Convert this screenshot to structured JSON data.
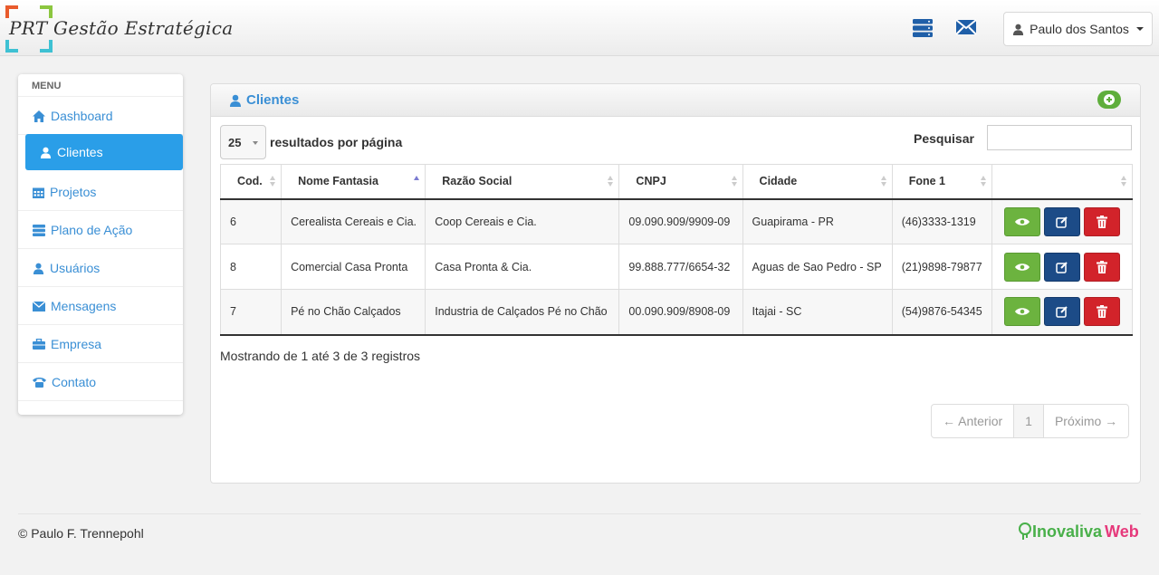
{
  "header": {
    "brand": "PRT Gestão Estratégica",
    "user_name": "Paulo dos Santos",
    "icons": [
      "server-icon",
      "envelope-icon"
    ],
    "brand_colors": [
      "#e95b2c",
      "#8cc63f",
      "#3ec1d3"
    ]
  },
  "sidebar": {
    "title": "MENU",
    "items": [
      {
        "label": "Dashboard",
        "icon": "home-icon",
        "active": false
      },
      {
        "label": "Clientes",
        "icon": "user-icon",
        "active": true
      },
      {
        "label": "Projetos",
        "icon": "calendar-icon",
        "active": false
      },
      {
        "label": "Plano de Ação",
        "icon": "list-icon",
        "active": false
      },
      {
        "label": "Usuários",
        "icon": "user-icon",
        "active": false
      },
      {
        "label": "Mensagens",
        "icon": "envelope-icon",
        "active": false
      },
      {
        "label": "Empresa",
        "icon": "briefcase-icon",
        "active": false
      },
      {
        "label": "Contato",
        "icon": "phone-icon",
        "active": false
      }
    ]
  },
  "panel": {
    "title": "Clientes",
    "per_page_value": "25",
    "per_page_label": "resultados por página",
    "search_label": "Pesquisar",
    "search_value": "",
    "columns": [
      "Cod.",
      "Nome Fantasia",
      "Razão Social",
      "CNPJ",
      "Cidade",
      "Fone 1",
      ""
    ],
    "rows": [
      {
        "cod": "6",
        "nome": "Cerealista Cereais e Cia.",
        "razao": "Coop Cereais e Cia.",
        "cnpj": "09.090.909/9909-09",
        "cidade": "Guapirama - PR",
        "fone": "(46)3333-1319"
      },
      {
        "cod": "8",
        "nome": "Comercial Casa Pronta",
        "razao": "Casa Pronta & Cia.",
        "cnpj": "99.888.777/6654-32",
        "cidade": "Aguas de Sao Pedro - SP",
        "fone": "(21)9898-79877"
      },
      {
        "cod": "7",
        "nome": "Pé no Chão Calçados",
        "razao": "Industria de Calçados Pé no Chão",
        "cnpj": "00.090.909/8908-09",
        "cidade": "Itajai - SC",
        "fone": "(54)9876-54345"
      }
    ],
    "info": "Mostrando de 1 até 3 de 3 registros",
    "pager": {
      "prev": "← Anterior",
      "page": "1",
      "next": "Próximo →"
    }
  },
  "footer": {
    "copyright": "© Paulo F. Trennepohl",
    "brand_part1": "Inovaliva",
    "brand_part2": "Web"
  }
}
